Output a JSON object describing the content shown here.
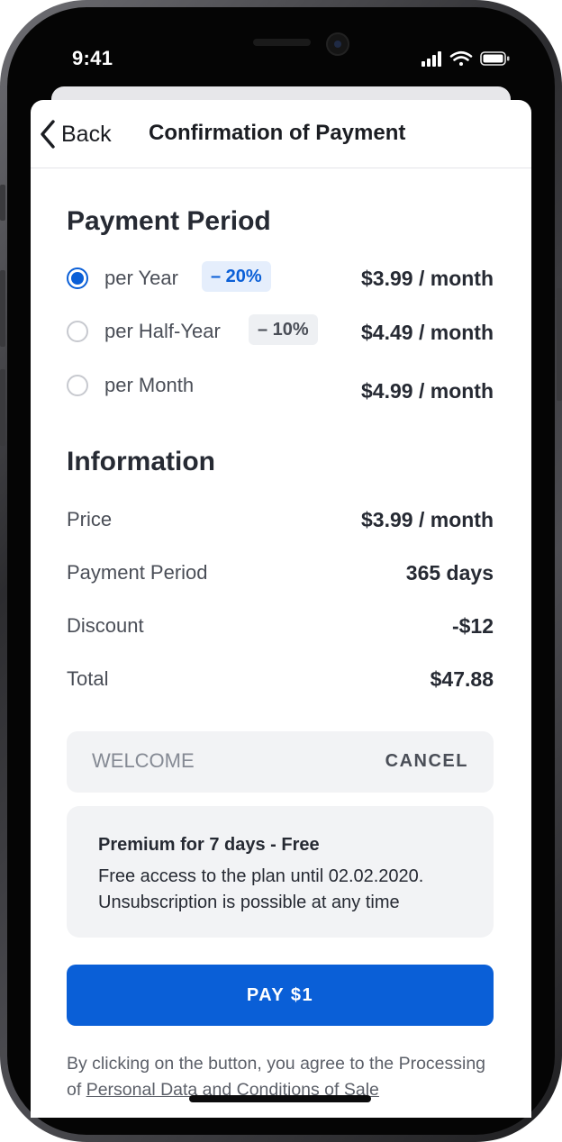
{
  "status_bar": {
    "time": "9:41"
  },
  "navbar": {
    "back_label": "Back",
    "title": "Confirmation of Payment"
  },
  "payment_period": {
    "title": "Payment Period",
    "options": [
      {
        "label": "per Year",
        "badge": "– 20%",
        "price": "$3.99 / month",
        "selected": true
      },
      {
        "label": "per Half-Year",
        "badge": "– 10%",
        "price": "$4.49 / month",
        "selected": false
      },
      {
        "label": "per Month",
        "badge": "",
        "price": "$4.99 / month",
        "selected": false
      }
    ]
  },
  "information": {
    "title": "Information",
    "rows": [
      {
        "label": "Price",
        "value": "$3.99 / month"
      },
      {
        "label": "Payment Period",
        "value": "365 days"
      },
      {
        "label": "Discount",
        "value": "-$12"
      },
      {
        "label": "Total",
        "value": "$47.88"
      }
    ]
  },
  "promo": {
    "value": "WELCOME",
    "cancel_label": "CANCEL"
  },
  "trial": {
    "title": "Premium for 7 days - Free",
    "line1": "Free access to the plan until 02.02.2020.",
    "line2": "Unsubscription is possible at any time"
  },
  "pay_button": {
    "label": "PAY $1"
  },
  "legal": {
    "prefix": "By clicking on the button, you agree to the Processing of ",
    "link": "Personal Data and Conditions of Sale"
  },
  "colors": {
    "accent": "#0a5fd7",
    "text": "#262a33",
    "muted": "#4a4e57"
  }
}
